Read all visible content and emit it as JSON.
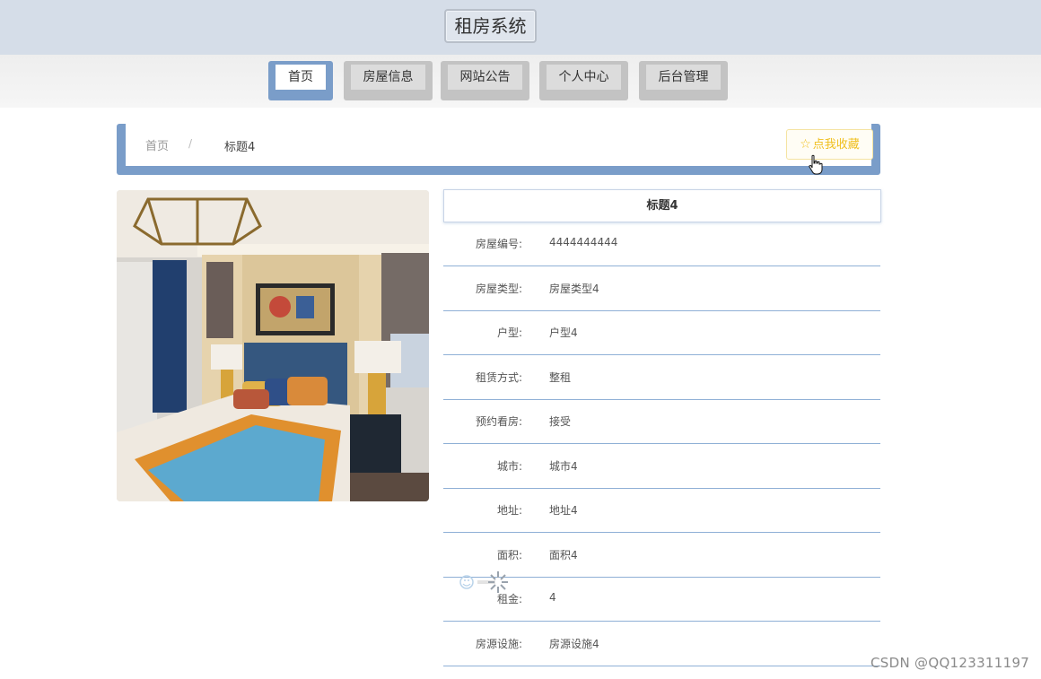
{
  "header": {
    "title": "租房系统"
  },
  "nav": {
    "items": [
      {
        "label": "首页",
        "active": true
      },
      {
        "label": "房屋信息",
        "active": false
      },
      {
        "label": "网站公告",
        "active": false
      },
      {
        "label": "个人中心",
        "active": false
      },
      {
        "label": "后台管理",
        "active": false
      }
    ]
  },
  "breadcrumb": {
    "home": "首页",
    "separator": "/",
    "current": "标题4"
  },
  "favorite": {
    "icon": "star-icon",
    "label": "点我收藏"
  },
  "detail": {
    "title": "标题4",
    "rows": [
      {
        "label": "房屋编号:",
        "value": "4444444444"
      },
      {
        "label": "房屋类型:",
        "value": "房屋类型4"
      },
      {
        "label": "户型:",
        "value": "户型4"
      },
      {
        "label": "租赁方式:",
        "value": "整租"
      },
      {
        "label": "预约看房:",
        "value": "接受"
      },
      {
        "label": "城市:",
        "value": "城市4"
      },
      {
        "label": "地址:",
        "value": "地址4"
      },
      {
        "label": "面积:",
        "value": "面积4"
      },
      {
        "label": "租金:",
        "value": "4"
      },
      {
        "label": "房源设施:",
        "value": "房源设施4"
      }
    ]
  },
  "watermark": "CSDN @QQ123311197",
  "colors": {
    "accent": "#7a9dc9",
    "favorite": "#f0c020",
    "header_bg": "#d5dde8"
  }
}
